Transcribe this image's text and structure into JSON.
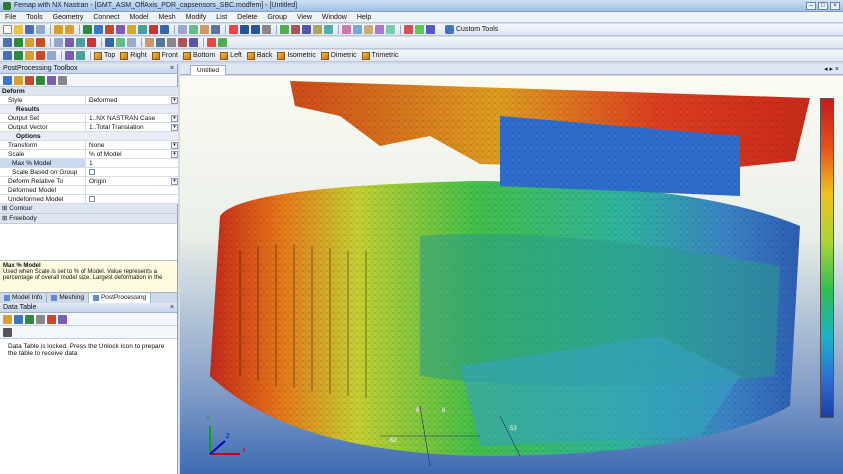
{
  "window": {
    "title": "Femap with NX Nastran - [GMT_ASM_OffAxis_PDR_capsensors_SBC.modfem] - [Untitled]"
  },
  "menu": [
    "File",
    "Tools",
    "Geometry",
    "Connect",
    "Model",
    "Mesh",
    "Modify",
    "List",
    "Delete",
    "Group",
    "View",
    "Window",
    "Help"
  ],
  "toolbar": {
    "custom_tools": "Custom Tools",
    "views": [
      "Top",
      "Right",
      "Front",
      "Bottom",
      "Left",
      "Back",
      "Isometric",
      "Dimetric",
      "Trimetric"
    ]
  },
  "postprocessing_toolbox": {
    "title": "PostProcessing Toolbox",
    "deform_group": "Deform",
    "style": {
      "label": "Style",
      "value": "Deformed"
    },
    "results_group": "Results",
    "output_set": {
      "label": "Output Set",
      "value": "1..NX NASTRAN Case"
    },
    "output_vector": {
      "label": "Output Vector",
      "value": "1..Total Translation"
    },
    "options_group": "Options",
    "transform": {
      "label": "Transform",
      "value": "None"
    },
    "scale": {
      "label": "Scale",
      "value": "% of Model"
    },
    "max_pct_model": {
      "label": "Max % Model",
      "value": "1"
    },
    "scale_based_on_group": {
      "label": "Scale Based on Group"
    },
    "deform_relative_to": {
      "label": "Deform Relative To",
      "value": "Origin"
    },
    "deformed_model": {
      "label": "Deformed Model"
    },
    "undeformed_model": {
      "label": "Undeformed Model"
    },
    "contour": "Contour",
    "freebody": "Freebody",
    "help_title": "Max % Model",
    "help_text": "Used when Scale is set to % of Model. Value represents a percentage of overall model size. Largest deformation in the"
  },
  "bottom_tabs": [
    "Model Info",
    "Meshing",
    "PostProcessing"
  ],
  "data_table": {
    "title": "Data Table",
    "message": "Data Table is locked. Press the Unlock Icon to prepare the table to receive data"
  },
  "viewport": {
    "tab": "Untitled",
    "axis_labels": [
      "6",
      "6",
      "62",
      "53",
      "X",
      "Y",
      "Z"
    ]
  },
  "colors": {
    "accent": "#3b78c4",
    "legend_high": "#c81a1a",
    "legend_low": "#1f3ca8"
  }
}
